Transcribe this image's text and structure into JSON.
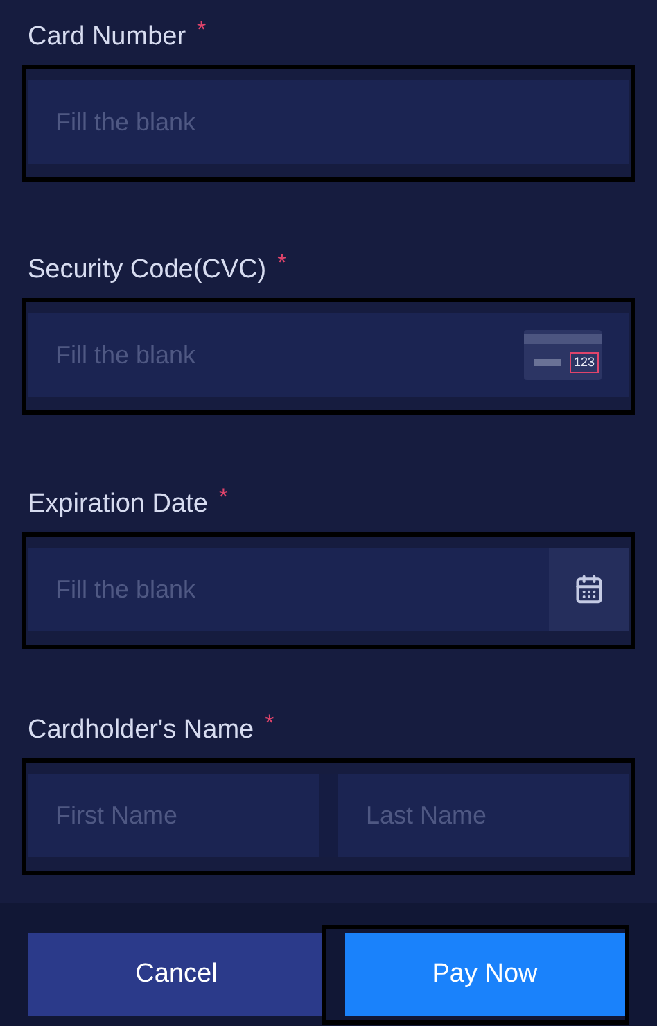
{
  "fields": [
    {
      "kind": "text",
      "label": "Card Number",
      "required_mark": "*",
      "placeholder": "Fill the blank"
    },
    {
      "kind": "cvc",
      "label": "Security Code(CVC)",
      "required_mark": "*",
      "placeholder": "Fill the blank",
      "hint": "123"
    },
    {
      "kind": "date",
      "label": "Expiration Date",
      "required_mark": "*",
      "placeholder": "Fill the blank"
    },
    {
      "kind": "name",
      "label": "Cardholder's Name",
      "required_mark": "*",
      "placeholders": [
        "First Name",
        "Last Name"
      ]
    }
  ],
  "buttons": [
    {
      "kind": "secondary",
      "label": "Cancel"
    },
    {
      "kind": "primary",
      "label": "Pay Now"
    }
  ]
}
